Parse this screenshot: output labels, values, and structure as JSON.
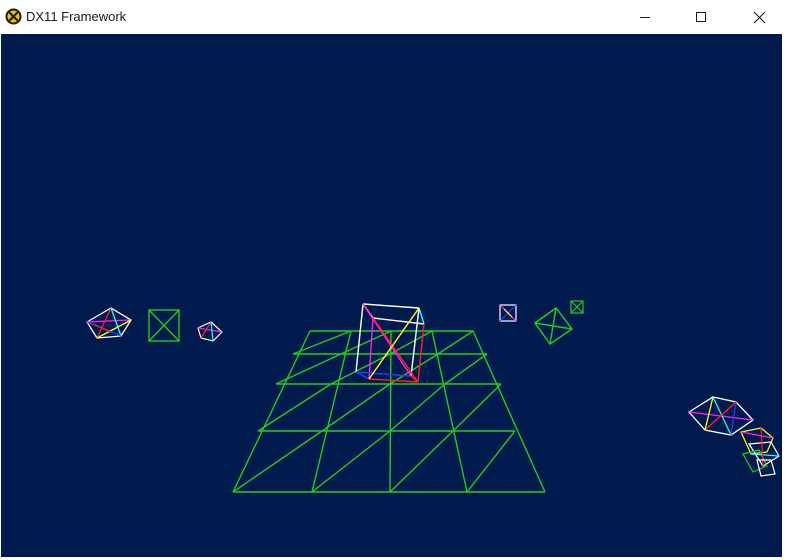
{
  "window": {
    "title": "DX11 Framework",
    "controls": {
      "minimize": "minimize-icon",
      "maximize": "maximize-icon",
      "close": "close-icon"
    }
  },
  "scene": {
    "background_color": "#001a4d",
    "grid_color": "#22cc22",
    "wire_colors": [
      "#ffffff",
      "#ff2020",
      "#ff20ff",
      "#2040ff",
      "#20ffff",
      "#ffff20",
      "#22cc22"
    ]
  }
}
